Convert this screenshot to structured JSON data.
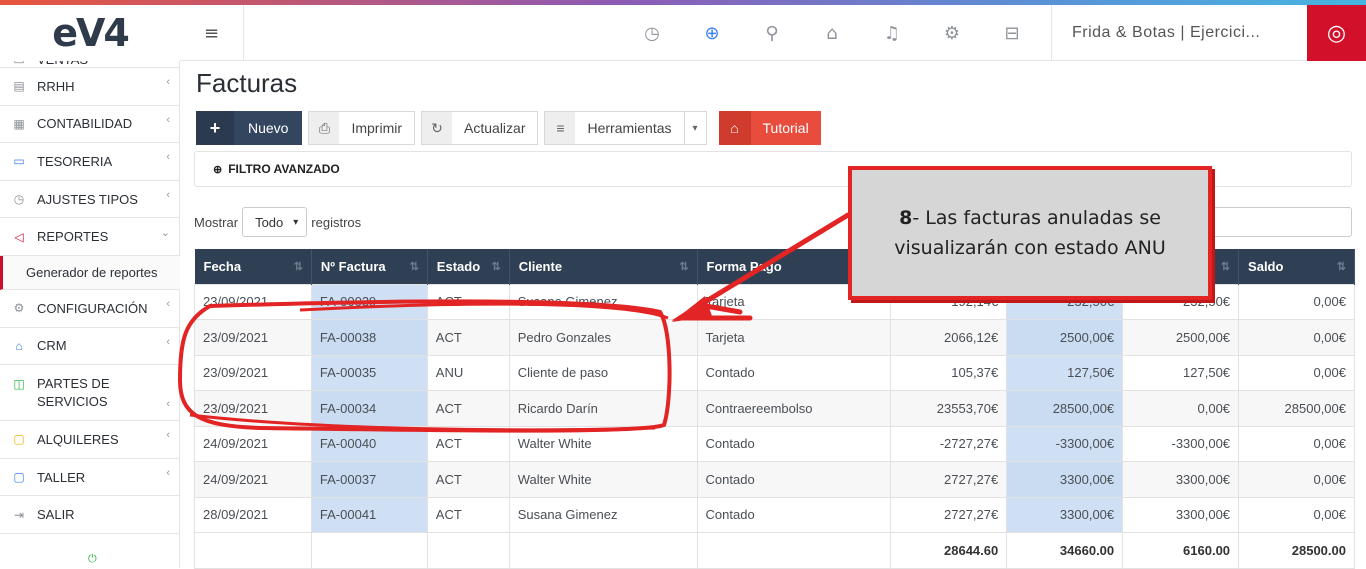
{
  "app": {
    "logo": "eV4"
  },
  "sidebar": {
    "items": [
      {
        "label": "VENTAS",
        "icon": "cart-icon"
      },
      {
        "label": "RRHH",
        "icon": "id-card-icon"
      },
      {
        "label": "CONTABILIDAD",
        "icon": "ledger-icon"
      },
      {
        "label": "TESORERIA",
        "icon": "card-icon"
      },
      {
        "label": "AJUSTES TIPOS",
        "icon": "clock-icon"
      },
      {
        "label": "REPORTES",
        "icon": "speaker-icon"
      }
    ],
    "sub_items": [
      {
        "label": "Generador de reportes"
      }
    ],
    "items_after": [
      {
        "label": "CONFIGURACIÓN",
        "icon": "gear-icon"
      },
      {
        "label": "CRM",
        "icon": "graduation-icon"
      },
      {
        "label": "PARTES DE SERVICIOS",
        "icon": "book-icon"
      },
      {
        "label": "ALQUILERES",
        "icon": "square-icon"
      },
      {
        "label": "TALLER",
        "icon": "square-icon"
      },
      {
        "label": "SALIR",
        "icon": "exit-icon"
      }
    ]
  },
  "topbar": {
    "company": "Frida & Botas | Ejercici...",
    "icons": [
      "history-icon",
      "plus-circle-icon",
      "search-icon",
      "home-icon",
      "bell-icon",
      "gear-icon",
      "briefcase-icon"
    ]
  },
  "page": {
    "title": "Facturas"
  },
  "toolbar": {
    "nuevo": "Nuevo",
    "imprimir": "Imprimir",
    "actualizar": "Actualizar",
    "herramientas": "Herramientas",
    "tutorial": "Tutorial"
  },
  "filter": {
    "label": "FILTRO AVANZADO"
  },
  "show": {
    "prefix": "Mostrar",
    "value": "Todo",
    "suffix": "registros"
  },
  "table": {
    "headers": [
      "Fecha",
      "Nº Factura",
      "Estado",
      "Cliente",
      "Forma Pago",
      "",
      "",
      "",
      "Saldo"
    ],
    "rows": [
      [
        "23/09/2021",
        "FA-00039",
        "ACT",
        "Susana Gimenez",
        "Tarjeta",
        "192,14€",
        "232,50€",
        "232,50€",
        "0,00€"
      ],
      [
        "23/09/2021",
        "FA-00038",
        "ACT",
        "Pedro Gonzales",
        "Tarjeta",
        "2066,12€",
        "2500,00€",
        "2500,00€",
        "0,00€"
      ],
      [
        "23/09/2021",
        "FA-00035",
        "ANU",
        "Cliente de paso",
        "Contado",
        "105,37€",
        "127,50€",
        "127,50€",
        "0,00€"
      ],
      [
        "23/09/2021",
        "FA-00034",
        "ACT",
        "Ricardo Darín",
        "Contraereembolso",
        "23553,70€",
        "28500,00€",
        "0,00€",
        "28500,00€"
      ],
      [
        "24/09/2021",
        "FA-00040",
        "ACT",
        "Walter White",
        "Contado",
        "-2727,27€",
        "-3300,00€",
        "-3300,00€",
        "0,00€"
      ],
      [
        "24/09/2021",
        "FA-00037",
        "ACT",
        "Walter White",
        "Contado",
        "2727,27€",
        "3300,00€",
        "3300,00€",
        "0,00€"
      ],
      [
        "28/09/2021",
        "FA-00041",
        "ACT",
        "Susana Gimenez",
        "Contado",
        "2727,27€",
        "3300,00€",
        "3300,00€",
        "0,00€"
      ]
    ],
    "totals": [
      "",
      "",
      "",
      "",
      "",
      "28644.60",
      "34660.00",
      "6160.00",
      "28500.00"
    ]
  },
  "callout": {
    "step": "8",
    "text": "- Las facturas anuladas se visualizarán con estado ANU"
  },
  "colors": {
    "accent_red": "#d2102a",
    "header_dark": "#2f4055",
    "tutorial": "#e74c3c"
  }
}
